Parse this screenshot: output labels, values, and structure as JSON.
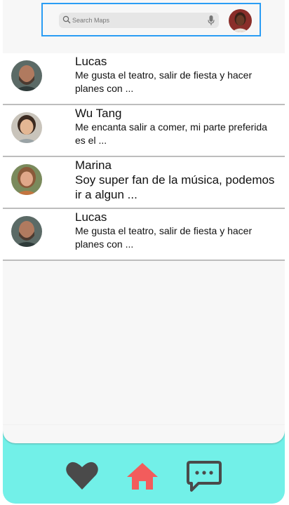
{
  "search": {
    "placeholder": "Search Maps"
  },
  "conversations": [
    {
      "name": "Lucas",
      "message": "Me gusta el teatro, salir de fiesta y hacer planes con ..."
    },
    {
      "name": "Wu Tang",
      "message": "Me encanta salir a comer, mi parte preferida es el ..."
    },
    {
      "name": "Marina",
      "message": "Soy super fan de la música, podemos ir a algun ..."
    },
    {
      "name": "Lucas",
      "message": "Me gusta el teatro, salir de fiesta y hacer planes con ..."
    }
  ],
  "bottom_nav": {
    "items": [
      {
        "icon": "heart-icon"
      },
      {
        "icon": "home-icon"
      },
      {
        "icon": "chat-icon"
      }
    ]
  },
  "colors": {
    "accent_nav": "#72f0e8",
    "home_active": "#f25c5c",
    "icon_dark": "#4a4a4a",
    "search_outline": "#2a9df4"
  }
}
